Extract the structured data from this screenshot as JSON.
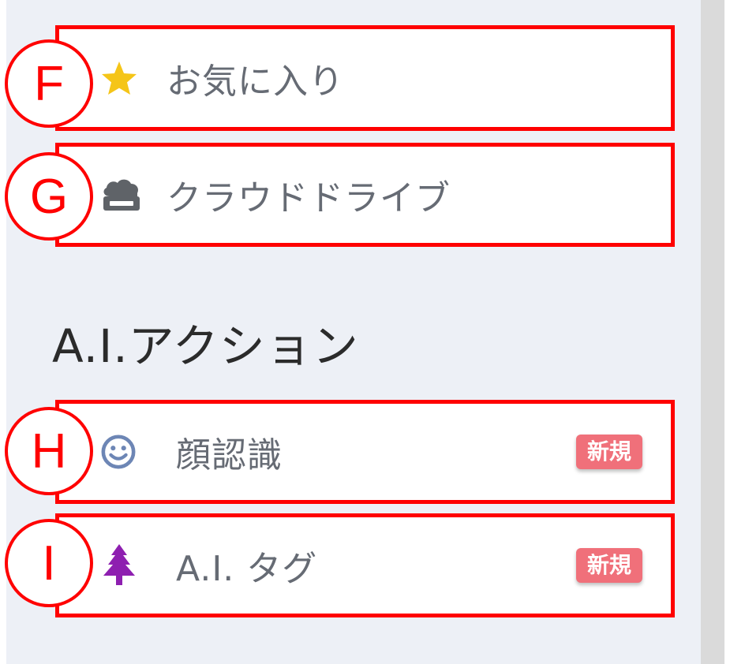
{
  "items": [
    {
      "marker": "F",
      "label": "お気に入り",
      "icon": "star-icon",
      "icon_color": "#f5c518"
    },
    {
      "marker": "G",
      "label": "クラウドドライブ",
      "icon": "cloud-drive-icon",
      "icon_color": "#5f6368"
    }
  ],
  "section": {
    "title": "A.I.アクション"
  },
  "ai_items": [
    {
      "marker": "H",
      "label": "顔認識",
      "icon": "smiley-face-icon",
      "icon_color": "#6d86b5",
      "badge": "新規"
    },
    {
      "marker": "I",
      "label": "A.I. タグ",
      "icon": "tree-icon",
      "icon_color": "#8e1fb0",
      "badge": "新規"
    }
  ],
  "colors": {
    "annotation": "#ff0000",
    "badge": "#f0707a",
    "panel_background": "#edf0f6",
    "scrollbar": "#dadada"
  }
}
